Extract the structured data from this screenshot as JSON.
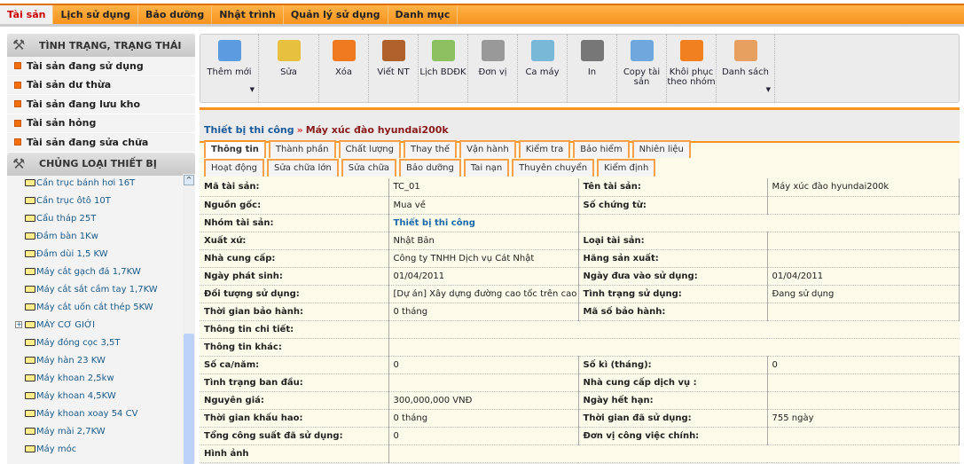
{
  "topnav": [
    "Tài sản",
    "Lịch sử dụng",
    "Bảo dưỡng",
    "Nhật trình",
    "Quản lý sử dụng",
    "Danh mục"
  ],
  "sidebar": {
    "status_header": "TÌNH TRẠNG, TRẠNG THÁI",
    "status_items": [
      "Tài sản đang sử dụng",
      "Tài sản dư thừa",
      "Tài sản đang lưu kho",
      "Tài sản hỏng",
      "Tài sản đang sửa chữa"
    ],
    "category_header": "CHỦNG LOẠI THIẾT BỊ",
    "tree": [
      "Cần trục bánh hơi 16T",
      "Cần trục ôtô 10T",
      "Cẩu tháp 25T",
      "Đầm bàn 1Kw",
      "Đầm dùi 1,5 KW",
      "Máy cắt gạch đá 1,7KW",
      "Máy cắt sắt cầm tay 1,7KW",
      "Máy cắt uốn cắt thép 5KW",
      "MÁY CƠ GIỚI",
      "Máy đóng cọc 3,5T",
      "Máy hàn 23 KW",
      "Máy khoan 2,5kw",
      "Máy khoan 4,5KW",
      "Máy khoan xoay 54 CV",
      "Máy mài 2,7KW",
      "Máy móc"
    ]
  },
  "toolbar": [
    {
      "label": "Thêm mới",
      "icon": "folder-add-icon",
      "color": "#5b9be0"
    },
    {
      "label": "Sửa",
      "icon": "pencil-icon",
      "color": "#e8c040"
    },
    {
      "label": "Xóa",
      "icon": "recycle-bin-icon",
      "color": "#f07a20"
    },
    {
      "label": "Viết NT",
      "icon": "notebook-icon",
      "color": "#b0602a"
    },
    {
      "label": "Lịch BDĐK",
      "icon": "calendar-add-icon",
      "color": "#8cc060"
    },
    {
      "label": "Đơn vị",
      "icon": "ruler-icon",
      "color": "#999999"
    },
    {
      "label": "Ca máy",
      "icon": "disc-icon",
      "color": "#7ab8d8"
    },
    {
      "label": "In",
      "icon": "printer-icon",
      "color": "#777777"
    },
    {
      "label": "Copy tài sản",
      "icon": "copy-icon",
      "color": "#6fa8dc"
    },
    {
      "label": "Khôi phục theo nhóm",
      "icon": "restore-icon",
      "color": "#f08020"
    },
    {
      "label": "Danh sách",
      "icon": "list-icon",
      "color": "#e8a060"
    }
  ],
  "breadcrumb": {
    "parent": "Thiết bị thi công",
    "separator": "»",
    "current": "Máy xúc đào hyundai200k"
  },
  "tabs_row1": [
    "Thông tin",
    "Thành phần",
    "Chất lượng",
    "Thay thế",
    "Vận hành",
    "Kiểm tra",
    "Bảo hiểm",
    "Nhiên liệu"
  ],
  "tabs_row2": [
    "Hoạt động",
    "Sửa chữa lớn",
    "Sửa chữa",
    "Bảo dưỡng",
    "Tai nạn",
    "Thuyên chuyển",
    "Kiểm định"
  ],
  "details": [
    [
      "Mã tài sản:",
      "TC_01",
      "Tên tài sản:",
      "Máy xúc đào hyundai200k"
    ],
    [
      "Nguồn gốc:",
      "Mua về",
      "Số chứng từ:",
      ""
    ],
    [
      "Nhóm tài sản:",
      "Thiết bị thi công",
      "",
      ""
    ],
    [
      "Xuất xứ:",
      "Nhật Bản",
      "Loại tài sản:",
      ""
    ],
    [
      "Nhà cung cấp:",
      "Công ty TNHH Dịch vụ Cát Nhật",
      "Hãng sản xuất:",
      ""
    ],
    [
      "Ngày phát sinh:",
      "01/04/2011",
      "Ngày đưa vào sử dụng:",
      "01/04/2011"
    ],
    [
      "Đối tượng sử dụng:",
      "[Dự án] Xây dựng đường cao tốc trên cao",
      "Tình trạng sử dụng:",
      "Đang sử dụng"
    ],
    [
      "Thời gian bảo hành:",
      "0 tháng",
      "Mã số bảo hành:",
      ""
    ],
    [
      "Thông tin chi tiết:",
      ""
    ],
    [
      "Thông tin khác:",
      ""
    ],
    [
      "Số ca/năm:",
      "0",
      "Số kì (tháng):",
      "0"
    ],
    [
      "Tình trạng ban đầu:",
      "",
      "Nhà cung cấp dịch vụ :",
      ""
    ],
    [
      "Nguyên giá:",
      "300,000,000 VNĐ",
      "Ngày hết hạn:",
      ""
    ],
    [
      "Thời gian khấu hao:",
      "0 tháng",
      "Thời gian đã sử dụng:",
      "755 ngày"
    ],
    [
      "Tổng công suất đã sử dụng:",
      "0",
      "Đơn vị công việc chính:",
      ""
    ],
    [
      "Hình ảnh",
      ""
    ]
  ]
}
